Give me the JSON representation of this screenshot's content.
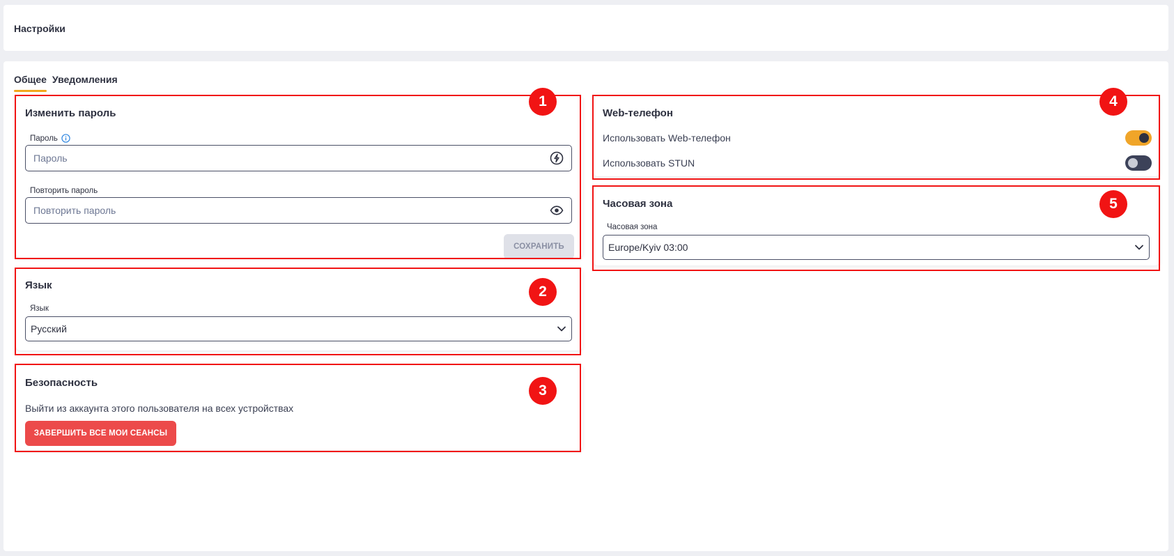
{
  "header": {
    "title": "Настройки"
  },
  "tabs": [
    {
      "label": "Общее",
      "active": true
    },
    {
      "label": "Уведомления",
      "active": false
    }
  ],
  "password_card": {
    "badge": "1",
    "title": "Изменить пароль",
    "password_label": "Пароль",
    "password_placeholder": "Пароль",
    "repeat_label": "Повторить пароль",
    "repeat_placeholder": "Повторить пароль",
    "save_label": "СОХРАНИТЬ"
  },
  "language_card": {
    "badge": "2",
    "title": "Язык",
    "label": "Язык",
    "value": "Русский"
  },
  "security_card": {
    "badge": "3",
    "title": "Безопасность",
    "text": "Выйти из аккаунта этого пользователя на всех устройствах",
    "button": "ЗАВЕРШИТЬ ВСЕ МОИ СЕАНСЫ"
  },
  "webphone_card": {
    "badge": "4",
    "title": "Web-телефон",
    "use_webphone_label": "Использовать Web-телефон",
    "use_webphone_on": true,
    "use_stun_label": "Использовать STUN",
    "use_stun_on": false
  },
  "timezone_card": {
    "badge": "5",
    "title": "Часовая зона",
    "label": "Часовая зона",
    "value": "Europe/Kyiv 03:00"
  },
  "colors": {
    "accent": "#f2a71c",
    "highlight": "#f11414",
    "danger": "#ec4a4a",
    "toggle_off": "#3c4259"
  },
  "icons": [
    "info-icon",
    "generate-password-icon",
    "eye-icon",
    "chevron-down-icon"
  ]
}
